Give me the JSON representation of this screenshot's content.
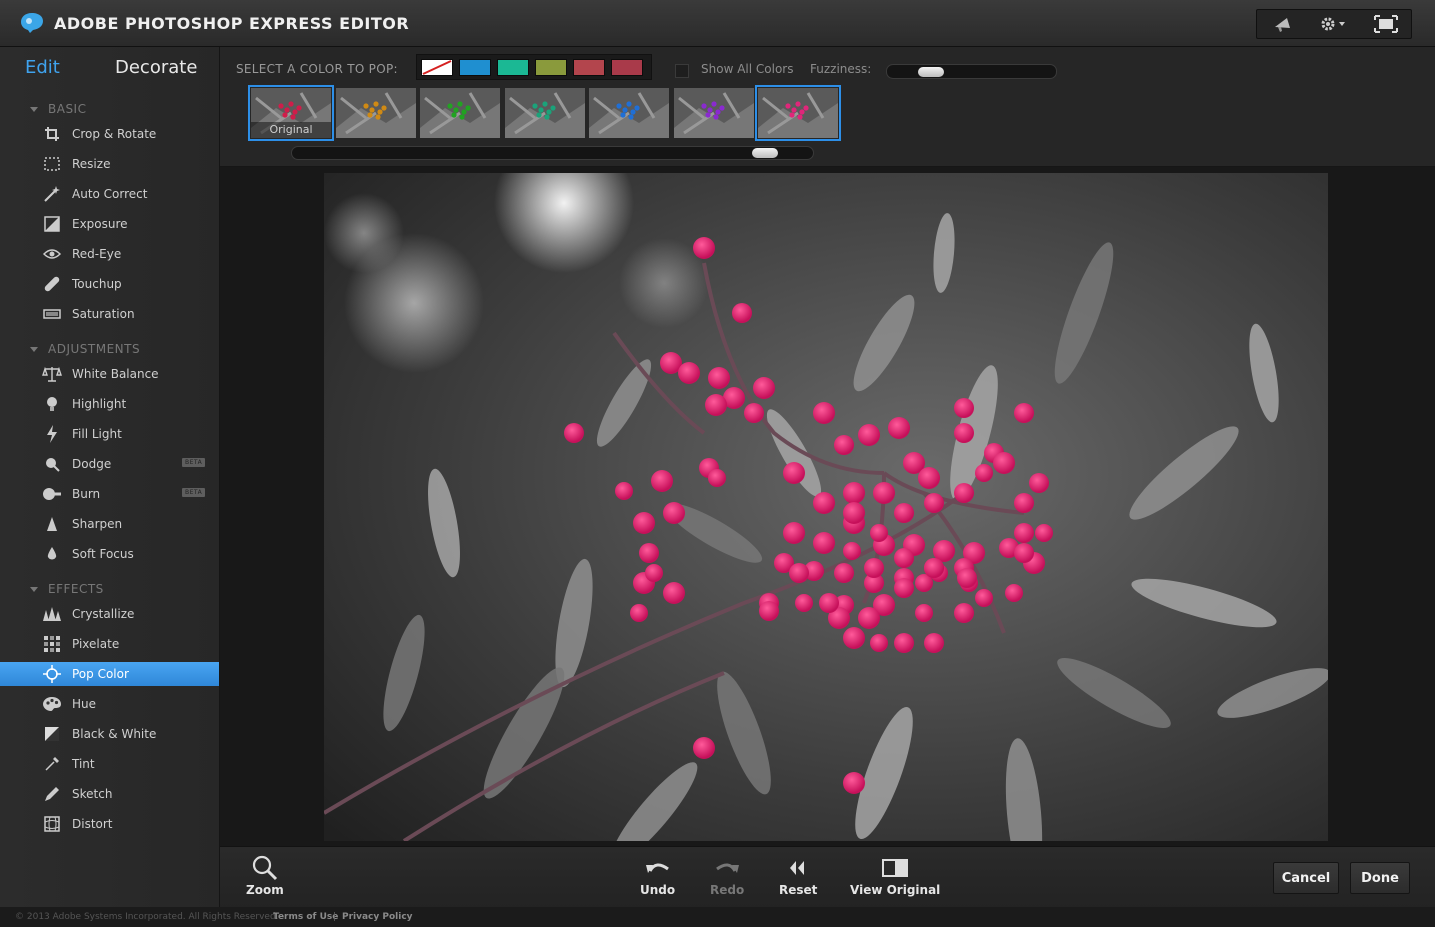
{
  "app": {
    "title": "ADOBE PHOTOSHOP EXPRESS EDITOR"
  },
  "modes": {
    "edit": "Edit",
    "decorate": "Decorate"
  },
  "sections": {
    "basic": "BASIC",
    "adjustments": "ADJUSTMENTS",
    "effects": "EFFECTS"
  },
  "tools": {
    "crop": "Crop & Rotate",
    "resize": "Resize",
    "auto_correct": "Auto Correct",
    "exposure": "Exposure",
    "red_eye": "Red-Eye",
    "touchup": "Touchup",
    "saturation": "Saturation",
    "white_balance": "White Balance",
    "highlight": "Highlight",
    "fill_light": "Fill Light",
    "dodge": "Dodge",
    "burn": "Burn",
    "sharpen": "Sharpen",
    "soft_focus": "Soft Focus",
    "crystallize": "Crystallize",
    "pixelate": "Pixelate",
    "pop_color": "Pop Color",
    "hue": "Hue",
    "black_white": "Black & White",
    "tint": "Tint",
    "sketch": "Sketch",
    "distort": "Distort"
  },
  "badges": {
    "beta": "BETA"
  },
  "options": {
    "select_label": "SELECT A COLOR TO POP:",
    "swatch_colors": [
      "none",
      "#1f8fd0",
      "#1bb894",
      "#8a9a3c",
      "#b3454d",
      "#a93a4a"
    ],
    "show_all_label": "Show All Colors",
    "show_all_checked": false,
    "fuzziness_label": "Fuzziness:",
    "fuzziness_level": 0.2,
    "thumb_caption": "Original",
    "thumb_tints": [
      "#d01d4a",
      "#d08a14",
      "#21a321",
      "#1ba37a",
      "#1f6fd6",
      "#8a2ad0",
      "#e0267a"
    ],
    "thumb_scroll": 0.93
  },
  "toolbar": {
    "zoom": "Zoom",
    "undo": "Undo",
    "redo": "Redo",
    "reset": "Reset",
    "view_original": "View Original",
    "cancel": "Cancel",
    "done": "Done"
  },
  "footer": {
    "copyright": "© 2013 Adobe Systems Incorporated. All Rights Reserved.",
    "terms": "Terms of Use",
    "separator": "|",
    "privacy": "Privacy Policy"
  },
  "colors": {
    "accent": "#3fa3ee",
    "pop": "#e8226e"
  }
}
